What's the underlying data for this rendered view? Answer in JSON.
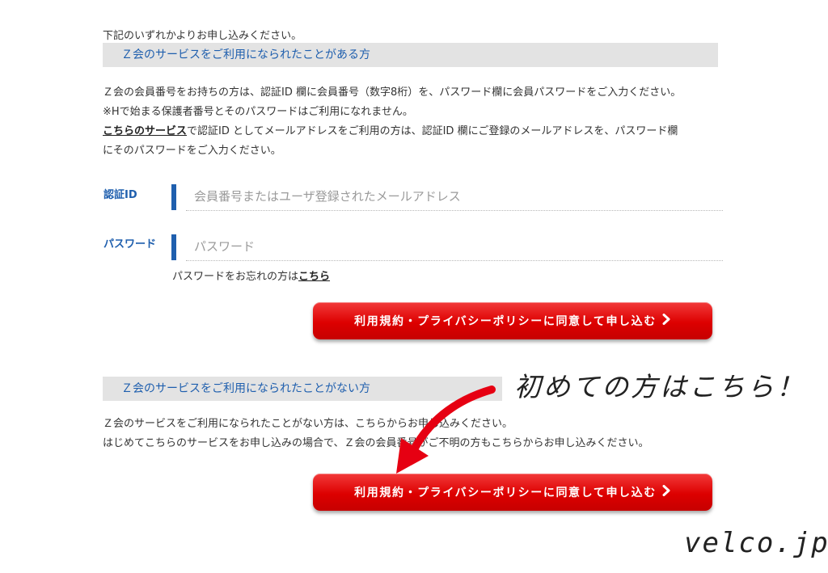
{
  "intro": "下記のいずれかよりお申し込みください。",
  "section1": {
    "title": "Ｚ会のサービスをご利用になられたことがある方",
    "line1": "Ｚ会の会員番号をお持ちの方は、認証ID 欄に会員番号（数字8桁）を、パスワード欄に会員パスワードをご入力ください。",
    "line2": "※Hで始まる保護者番号とそのパスワードはご利用になれません。",
    "line3_link": "こちらのサービス",
    "line3_rest": "で認証ID としてメールアドレスをご利用の方は、認証ID 欄にご登録のメールアドレスを、パスワード欄",
    "line4": "にそのパスワードをご入力ください。"
  },
  "form": {
    "id_label": "認証ID",
    "id_placeholder": "会員番号またはユーザ登録されたメールアドレス",
    "pw_label": "パスワード",
    "pw_placeholder": "パスワード",
    "forgot_text": "パスワードをお忘れの方は",
    "forgot_link": "こちら"
  },
  "agree_button_label": "利用規約・プライバシーポリシーに同意して申し込む",
  "section2": {
    "title": "Ｚ会のサービスをご利用になられたことがない方",
    "line1": "Ｚ会のサービスをご利用になられたことがない方は、こちらからお申し込みください。",
    "line2": "はじめてこちらのサービスをお申し込みの場合で、Ｚ会の会員番号がご不明の方もこちらからお申し込みください。"
  },
  "annotation": "初めての方はこちら！",
  "watermark": "velco.jp",
  "icons": {
    "button_chevron": "chevron-right-icon",
    "annotation_arrow": "curved-arrow-icon"
  },
  "colors": {
    "accent_blue": "#1f5fae",
    "button_red": "#dd0000",
    "section_bg": "#e3e3e3"
  }
}
